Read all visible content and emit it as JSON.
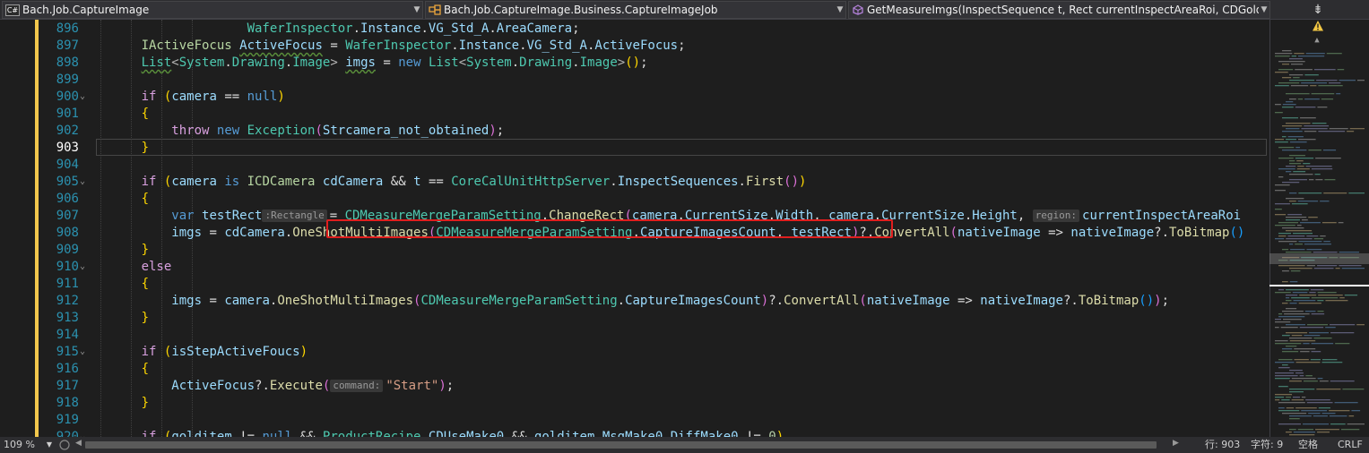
{
  "navbar": {
    "project_badge": "C#",
    "project": "Bach.Job.CaptureImage",
    "type": "Bach.Job.CaptureImage.Business.CaptureImageJob",
    "member": "GetMeasureImgs(InspectSequence t, Rect currentInspectAreaRoi, CDGoldren goldit"
  },
  "editor": {
    "current_line": "903",
    "line_numbers": [
      "896",
      "897",
      "898",
      "899",
      "900",
      "901",
      "902",
      "903",
      "904",
      "905",
      "906",
      "907",
      "908",
      "909",
      "910",
      "911",
      "912",
      "913",
      "914",
      "915",
      "916",
      "917",
      "918",
      "919",
      "920"
    ],
    "hints": {
      "rect_type": ":Rectangle",
      "region": "region:",
      "command": "command:"
    },
    "strings": {
      "start": "\"Start\""
    }
  },
  "statusbar": {
    "zoom": "109 %",
    "line": "行: 903",
    "char": "字符: 9",
    "whitespace": "空格",
    "line_ending": "CRLF"
  },
  "colors": {
    "accent_highlight": "#e01e1e",
    "change_bar": "#f2c74c",
    "line_number": "#2b91af",
    "keyword": "#569cd6",
    "type": "#4ec9b0"
  }
}
